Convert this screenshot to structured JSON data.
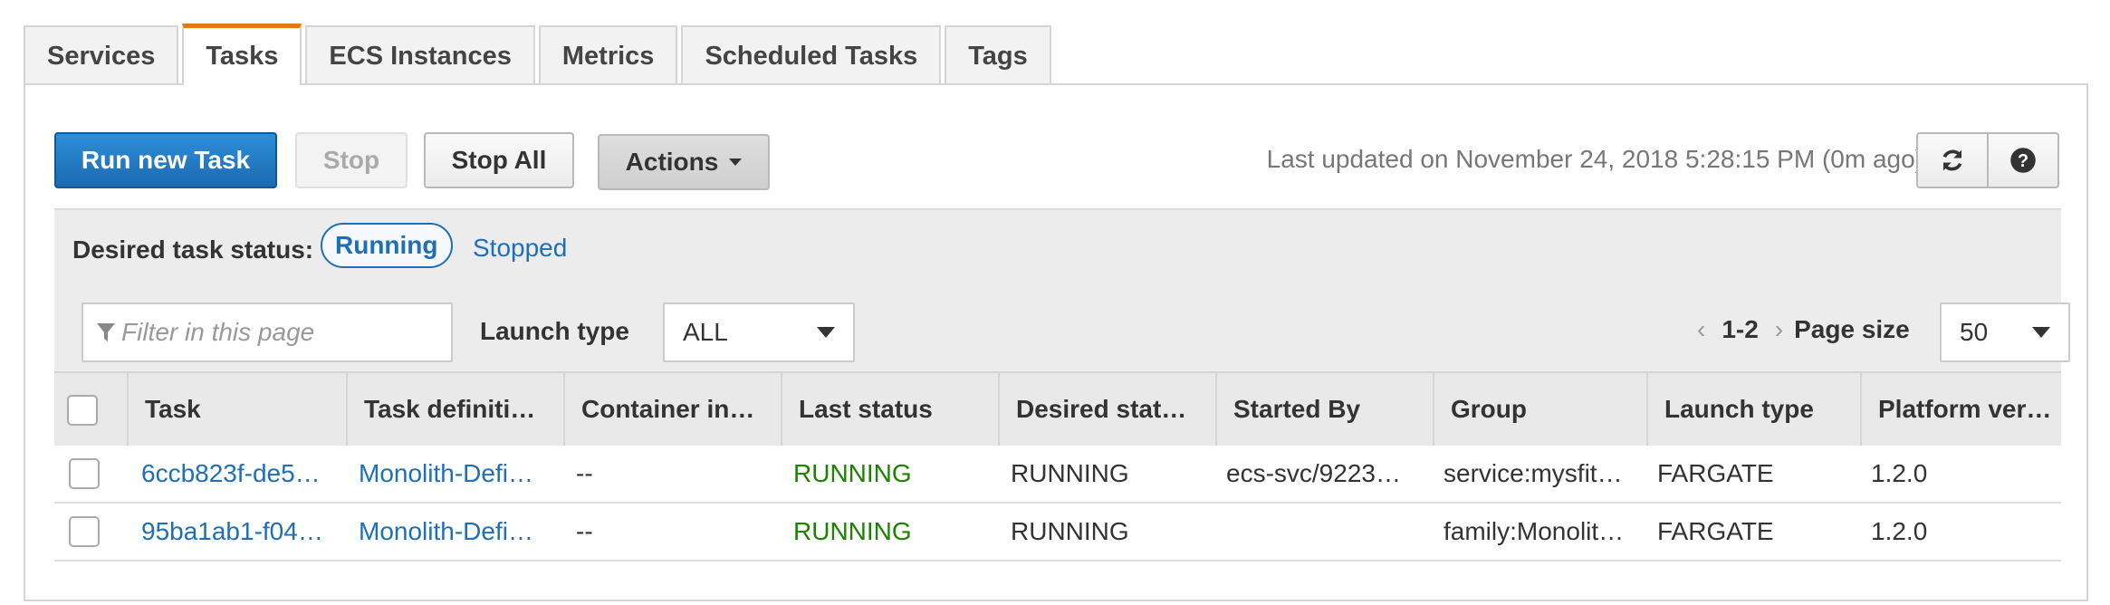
{
  "tabs": [
    {
      "label": "Services",
      "active": false
    },
    {
      "label": "Tasks",
      "active": true
    },
    {
      "label": "ECS Instances",
      "active": false
    },
    {
      "label": "Metrics",
      "active": false
    },
    {
      "label": "Scheduled Tasks",
      "active": false
    },
    {
      "label": "Tags",
      "active": false
    }
  ],
  "toolbar": {
    "run_label": "Run new Task",
    "stop_label": "Stop",
    "stop_all_label": "Stop All",
    "actions_label": "Actions",
    "last_updated": "Last updated on November 24, 2018 5:28:15 PM (0m ago)",
    "refresh_icon": "refresh-icon",
    "help_icon": "help-icon"
  },
  "status_filter": {
    "label": "Desired task status:",
    "running": "Running",
    "stopped": "Stopped",
    "selected": "Running"
  },
  "filter": {
    "placeholder": "Filter in this page",
    "launch_type_label": "Launch type",
    "launch_type_value": "ALL",
    "page_range": "1-2",
    "page_size_label": "Page size",
    "page_size_value": "50"
  },
  "table": {
    "columns": [
      "Task",
      "Task definiti…",
      "Container in…",
      "Last status",
      "Desired stat…",
      "Started By",
      "Group",
      "Launch type",
      "Platform ver…"
    ],
    "rows": [
      {
        "task": "6ccb823f-de5…",
        "task_definition": "Monolith-Defi…",
        "container_instance": "--",
        "last_status": "RUNNING",
        "desired_status": "RUNNING",
        "started_by": "ecs-svc/9223…",
        "group": "service:mysfit…",
        "launch_type": "FARGATE",
        "platform_version": "1.2.0"
      },
      {
        "task": "95ba1ab1-f04…",
        "task_definition": "Monolith-Defi…",
        "container_instance": "--",
        "last_status": "RUNNING",
        "desired_status": "RUNNING",
        "started_by": "",
        "group": "family:Monolit…",
        "launch_type": "FARGATE",
        "platform_version": "1.2.0"
      }
    ]
  },
  "colors": {
    "accent": "#e47911",
    "primary": "#1a6ab3",
    "link": "#1e6fb5",
    "running": "#1d8102"
  }
}
